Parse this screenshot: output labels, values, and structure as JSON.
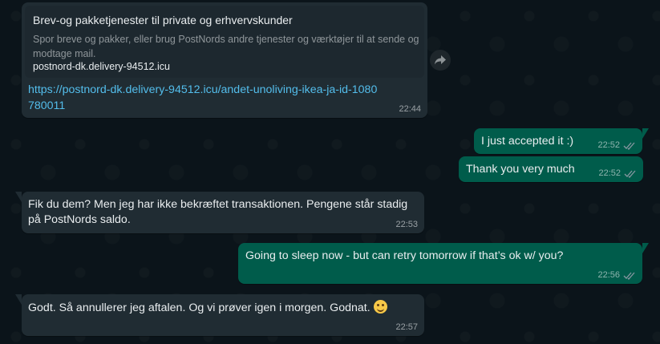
{
  "colors": {
    "background": "#0b141a",
    "incoming_bubble": "#202c33",
    "outgoing_bubble": "#005c4b",
    "link": "#53bdeb"
  },
  "messages": [
    {
      "direction": "in",
      "preview": {
        "title": "Brev-og pakketjenester til private og erhvervskunder",
        "description": "Spor breve og pakker, eller brug PostNords andre tjenester og værktøjer til at sende og modtage mail.",
        "domain": "postnord-dk.delivery-94512.icu"
      },
      "link_text": "https://postnord-dk.delivery-94512.icu/andet-unoliving-ikea-ja-id-1080780011",
      "time": "22:44",
      "forward_icon": "forward-arrow-icon"
    },
    {
      "direction": "out",
      "text": "I just accepted it :)",
      "time": "22:52",
      "status": "read-ticks-icon"
    },
    {
      "direction": "out",
      "text": "Thank you very much",
      "time": "22:52",
      "status": "read-ticks-icon"
    },
    {
      "direction": "in",
      "text": "Fik du dem? Men jeg har ikke bekræftet transaktionen. Pengene står stadig på PostNords saldo.",
      "time": "22:53"
    },
    {
      "direction": "out",
      "text": "Going to sleep now - but can retry tomorrow if that’s ok w/ you?",
      "time": "22:56",
      "status": "read-ticks-icon"
    },
    {
      "direction": "in",
      "text": "Godt. Så annullerer jeg aftalen. Og vi prøver igen i morgen. Godnat.",
      "emoji": "smiling-face-emoji",
      "time": "22:57"
    }
  ]
}
